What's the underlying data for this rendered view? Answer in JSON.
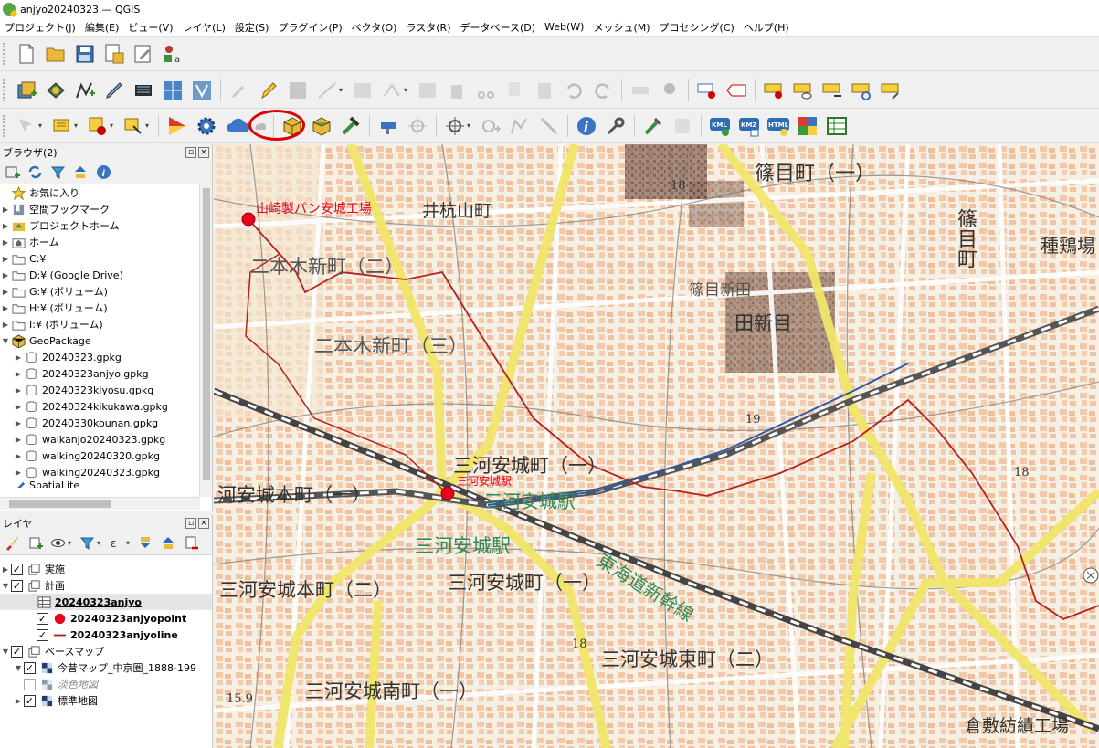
{
  "window": {
    "title": "anjyo20240323 — QGIS"
  },
  "menu": [
    "プロジェクト(J)",
    "編集(E)",
    "ビュー(V)",
    "レイヤ(L)",
    "設定(S)",
    "プラグイン(P)",
    "ベクタ(O)",
    "ラスタ(R)",
    "データベース(D)",
    "Web(W)",
    "メッシュ(M)",
    "プロセシング(C)",
    "ヘルプ(H)"
  ],
  "toolbar3": {
    "kml": "KML",
    "kmz": "KMZ",
    "html": "HTML"
  },
  "browser": {
    "title": "ブラウザ(2)",
    "items": [
      {
        "label": "お気に入り",
        "icon": "star-icon"
      },
      {
        "label": "空間ブックマーク",
        "icon": "bookmark-icon"
      },
      {
        "label": "プロジェクトホーム",
        "icon": "project-home-icon"
      },
      {
        "label": "ホーム",
        "icon": "home-folder-icon"
      },
      {
        "label": "C:¥",
        "icon": "folder-icon"
      },
      {
        "label": "D:¥ (Google Drive)",
        "icon": "folder-icon"
      },
      {
        "label": "G:¥ (ボリューム)",
        "icon": "folder-icon"
      },
      {
        "label": "H:¥ (ボリューム)",
        "icon": "folder-icon"
      },
      {
        "label": "I:¥ (ボリューム)",
        "icon": "folder-icon"
      },
      {
        "label": "GeoPackage",
        "icon": "geopackage-icon"
      }
    ],
    "geopackages": [
      "20240323.gpkg",
      "20240323anjyo.gpkg",
      "20240323kiyosu.gpkg",
      "20240324kikukawa.gpkg",
      "20240330kounan.gpkg",
      "walkanjo20240323.gpkg",
      "walking20240320.gpkg",
      "walking20240323.gpkg"
    ],
    "partial": "SpatiaLite"
  },
  "layers": {
    "title": "レイヤ",
    "groups": {
      "jisshi": "実施",
      "keikaku": "計画",
      "anjyo": "20240323anjyo",
      "point": "20240323anjyopoint",
      "line": "20240323anjyoline",
      "basemap": "ベースマップ",
      "konjaku": "今昔マップ_中京圏_1888-199",
      "awairo": "淡色地図",
      "hyojun": "標準地図"
    }
  },
  "map": {
    "point_labels": [
      "山崎製パン安城工場",
      "三河安城駅"
    ],
    "place_labels": [
      "篠目町（一）",
      "井杭山町",
      "二本木新町（二）",
      "二本木新町（三）",
      "篠目新田",
      "篠目町",
      "篠目新",
      "田新目",
      "三河安城町（一）",
      "河安城本町（一）",
      "三河安城駅",
      "三河安城本町（二）",
      "三河安城町（一）",
      "三河安城東町（二）",
      "三河安城南町（一）",
      "倉敷紡績工場",
      "種鶏場",
      "東海道新幹線",
      "三河安城駅",
      "18",
      "19",
      "18",
      "18",
      "15.9"
    ]
  },
  "colors": {
    "highlight": "#e00000",
    "track": "#b22222",
    "point": "#e8001c",
    "road": "#f0e66a"
  }
}
